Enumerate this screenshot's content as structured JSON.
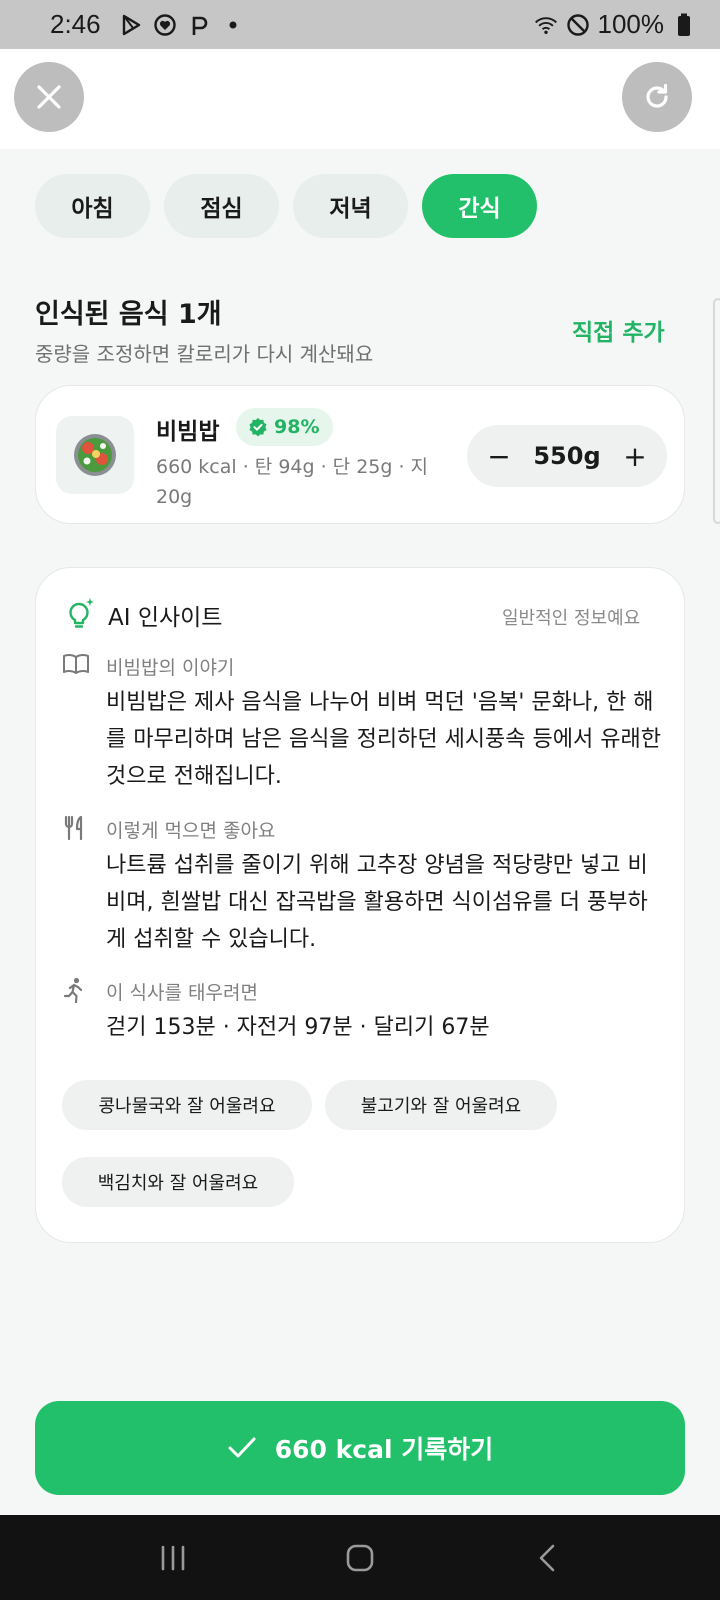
{
  "status_bar": {
    "time": "2:46",
    "battery": "100%",
    "icons": [
      "play-store-icon",
      "heart-shield-icon",
      "p-app-icon",
      "dot-icon",
      "wifi-icon",
      "do-not-disturb-icon",
      "battery-icon"
    ]
  },
  "top_bar": {
    "close_icon": "close-icon",
    "refresh_icon": "refresh-icon"
  },
  "meal_tabs": [
    {
      "label": "아침",
      "active": false
    },
    {
      "label": "점심",
      "active": false
    },
    {
      "label": "저녁",
      "active": false
    },
    {
      "label": "간식",
      "active": true
    }
  ],
  "recognized": {
    "title": "인식된 음식 1개",
    "subtitle": "중량을 조정하면 칼로리가 다시 계산돼요",
    "add_label": "직접 추가"
  },
  "food": {
    "name": "비빔밥",
    "confidence": "98%",
    "nutrition": "660 kcal · 탄 94g · 단 25g · 지 20g",
    "weight": "550g",
    "minus": "−",
    "plus": "+"
  },
  "insight": {
    "title": "AI 인사이트",
    "note": "일반적인 정보예요",
    "story_label": "비빔밥의 이야기",
    "story_body": "비빔밥은 제사 음식을 나누어 비벼 먹던 '음복' 문화나, 한 해를 마무리하며 남은 음식을 정리하던 세시풍속 등에서 유래한 것으로 전해집니다.",
    "tip_label": "이렇게 먹으면 좋아요",
    "tip_body": "나트륨 섭취를 줄이기 위해 고추장 양념을 적당량만 넣고 비비며, 흰쌀밥 대신 잡곡밥을 활용하면 식이섬유를 더 풍부하게 섭취할 수 있습니다.",
    "burn_label": "이 식사를 태우려면",
    "burn_body": "걷기 153분 · 자전거 97분 · 달리기 67분",
    "pairings": [
      "콩나물국와 잘 어울려요",
      "불고기와 잘 어울려요",
      "백김치와 잘 어울려요"
    ]
  },
  "record_button": {
    "label": "660 kcal 기록하기"
  },
  "colors": {
    "accent": "#22c06a",
    "accent_text": "#22b464",
    "background": "#f4f7f6"
  }
}
